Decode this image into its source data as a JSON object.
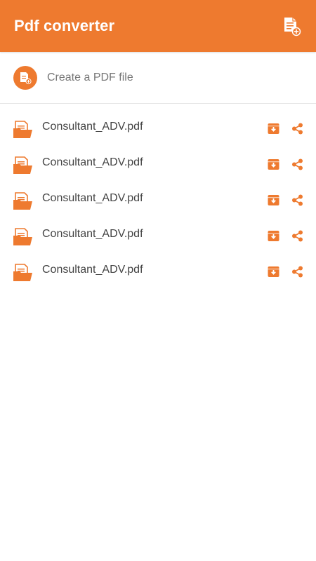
{
  "appbar": {
    "title": "Pdf converter",
    "action_icon": "add-document-icon"
  },
  "create": {
    "label": "Create a PDF file",
    "icon": "add-document-icon"
  },
  "files": [
    {
      "name": "Consultant_ADV.pdf"
    },
    {
      "name": "Consultant_ADV.pdf"
    },
    {
      "name": "Consultant_ADV.pdf"
    },
    {
      "name": "Consultant_ADV.pdf"
    },
    {
      "name": "Consultant_ADV.pdf"
    }
  ],
  "colors": {
    "accent": "#EE7A2F",
    "text": "#444444",
    "muted": "#777777"
  }
}
